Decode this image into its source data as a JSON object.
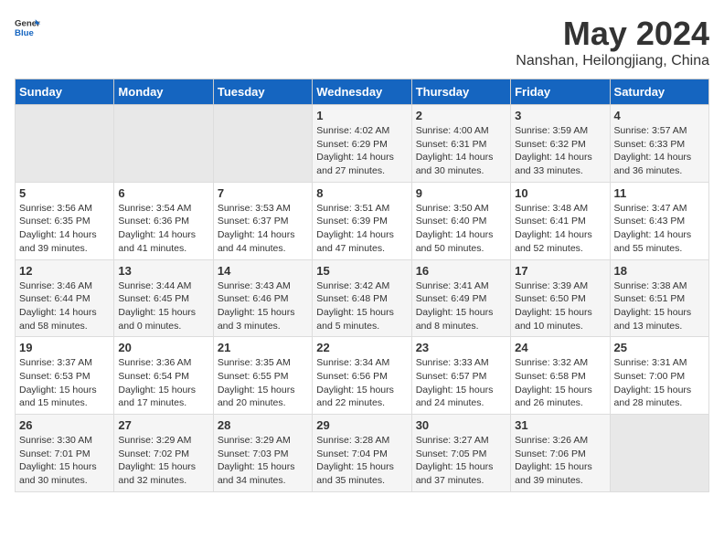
{
  "header": {
    "logo_general": "General",
    "logo_blue": "Blue",
    "main_title": "May 2024",
    "subtitle": "Nanshan, Heilongjiang, China"
  },
  "days_of_week": [
    "Sunday",
    "Monday",
    "Tuesday",
    "Wednesday",
    "Thursday",
    "Friday",
    "Saturday"
  ],
  "weeks": [
    [
      {
        "num": "",
        "sunrise": "",
        "sunset": "",
        "daylight": "",
        "empty": true
      },
      {
        "num": "",
        "sunrise": "",
        "sunset": "",
        "daylight": "",
        "empty": true
      },
      {
        "num": "",
        "sunrise": "",
        "sunset": "",
        "daylight": "",
        "empty": true
      },
      {
        "num": "1",
        "sunrise": "Sunrise: 4:02 AM",
        "sunset": "Sunset: 6:29 PM",
        "daylight": "Daylight: 14 hours and 27 minutes.",
        "empty": false
      },
      {
        "num": "2",
        "sunrise": "Sunrise: 4:00 AM",
        "sunset": "Sunset: 6:31 PM",
        "daylight": "Daylight: 14 hours and 30 minutes.",
        "empty": false
      },
      {
        "num": "3",
        "sunrise": "Sunrise: 3:59 AM",
        "sunset": "Sunset: 6:32 PM",
        "daylight": "Daylight: 14 hours and 33 minutes.",
        "empty": false
      },
      {
        "num": "4",
        "sunrise": "Sunrise: 3:57 AM",
        "sunset": "Sunset: 6:33 PM",
        "daylight": "Daylight: 14 hours and 36 minutes.",
        "empty": false
      }
    ],
    [
      {
        "num": "5",
        "sunrise": "Sunrise: 3:56 AM",
        "sunset": "Sunset: 6:35 PM",
        "daylight": "Daylight: 14 hours and 39 minutes.",
        "empty": false
      },
      {
        "num": "6",
        "sunrise": "Sunrise: 3:54 AM",
        "sunset": "Sunset: 6:36 PM",
        "daylight": "Daylight: 14 hours and 41 minutes.",
        "empty": false
      },
      {
        "num": "7",
        "sunrise": "Sunrise: 3:53 AM",
        "sunset": "Sunset: 6:37 PM",
        "daylight": "Daylight: 14 hours and 44 minutes.",
        "empty": false
      },
      {
        "num": "8",
        "sunrise": "Sunrise: 3:51 AM",
        "sunset": "Sunset: 6:39 PM",
        "daylight": "Daylight: 14 hours and 47 minutes.",
        "empty": false
      },
      {
        "num": "9",
        "sunrise": "Sunrise: 3:50 AM",
        "sunset": "Sunset: 6:40 PM",
        "daylight": "Daylight: 14 hours and 50 minutes.",
        "empty": false
      },
      {
        "num": "10",
        "sunrise": "Sunrise: 3:48 AM",
        "sunset": "Sunset: 6:41 PM",
        "daylight": "Daylight: 14 hours and 52 minutes.",
        "empty": false
      },
      {
        "num": "11",
        "sunrise": "Sunrise: 3:47 AM",
        "sunset": "Sunset: 6:43 PM",
        "daylight": "Daylight: 14 hours and 55 minutes.",
        "empty": false
      }
    ],
    [
      {
        "num": "12",
        "sunrise": "Sunrise: 3:46 AM",
        "sunset": "Sunset: 6:44 PM",
        "daylight": "Daylight: 14 hours and 58 minutes.",
        "empty": false
      },
      {
        "num": "13",
        "sunrise": "Sunrise: 3:44 AM",
        "sunset": "Sunset: 6:45 PM",
        "daylight": "Daylight: 15 hours and 0 minutes.",
        "empty": false
      },
      {
        "num": "14",
        "sunrise": "Sunrise: 3:43 AM",
        "sunset": "Sunset: 6:46 PM",
        "daylight": "Daylight: 15 hours and 3 minutes.",
        "empty": false
      },
      {
        "num": "15",
        "sunrise": "Sunrise: 3:42 AM",
        "sunset": "Sunset: 6:48 PM",
        "daylight": "Daylight: 15 hours and 5 minutes.",
        "empty": false
      },
      {
        "num": "16",
        "sunrise": "Sunrise: 3:41 AM",
        "sunset": "Sunset: 6:49 PM",
        "daylight": "Daylight: 15 hours and 8 minutes.",
        "empty": false
      },
      {
        "num": "17",
        "sunrise": "Sunrise: 3:39 AM",
        "sunset": "Sunset: 6:50 PM",
        "daylight": "Daylight: 15 hours and 10 minutes.",
        "empty": false
      },
      {
        "num": "18",
        "sunrise": "Sunrise: 3:38 AM",
        "sunset": "Sunset: 6:51 PM",
        "daylight": "Daylight: 15 hours and 13 minutes.",
        "empty": false
      }
    ],
    [
      {
        "num": "19",
        "sunrise": "Sunrise: 3:37 AM",
        "sunset": "Sunset: 6:53 PM",
        "daylight": "Daylight: 15 hours and 15 minutes.",
        "empty": false
      },
      {
        "num": "20",
        "sunrise": "Sunrise: 3:36 AM",
        "sunset": "Sunset: 6:54 PM",
        "daylight": "Daylight: 15 hours and 17 minutes.",
        "empty": false
      },
      {
        "num": "21",
        "sunrise": "Sunrise: 3:35 AM",
        "sunset": "Sunset: 6:55 PM",
        "daylight": "Daylight: 15 hours and 20 minutes.",
        "empty": false
      },
      {
        "num": "22",
        "sunrise": "Sunrise: 3:34 AM",
        "sunset": "Sunset: 6:56 PM",
        "daylight": "Daylight: 15 hours and 22 minutes.",
        "empty": false
      },
      {
        "num": "23",
        "sunrise": "Sunrise: 3:33 AM",
        "sunset": "Sunset: 6:57 PM",
        "daylight": "Daylight: 15 hours and 24 minutes.",
        "empty": false
      },
      {
        "num": "24",
        "sunrise": "Sunrise: 3:32 AM",
        "sunset": "Sunset: 6:58 PM",
        "daylight": "Daylight: 15 hours and 26 minutes.",
        "empty": false
      },
      {
        "num": "25",
        "sunrise": "Sunrise: 3:31 AM",
        "sunset": "Sunset: 7:00 PM",
        "daylight": "Daylight: 15 hours and 28 minutes.",
        "empty": false
      }
    ],
    [
      {
        "num": "26",
        "sunrise": "Sunrise: 3:30 AM",
        "sunset": "Sunset: 7:01 PM",
        "daylight": "Daylight: 15 hours and 30 minutes.",
        "empty": false
      },
      {
        "num": "27",
        "sunrise": "Sunrise: 3:29 AM",
        "sunset": "Sunset: 7:02 PM",
        "daylight": "Daylight: 15 hours and 32 minutes.",
        "empty": false
      },
      {
        "num": "28",
        "sunrise": "Sunrise: 3:29 AM",
        "sunset": "Sunset: 7:03 PM",
        "daylight": "Daylight: 15 hours and 34 minutes.",
        "empty": false
      },
      {
        "num": "29",
        "sunrise": "Sunrise: 3:28 AM",
        "sunset": "Sunset: 7:04 PM",
        "daylight": "Daylight: 15 hours and 35 minutes.",
        "empty": false
      },
      {
        "num": "30",
        "sunrise": "Sunrise: 3:27 AM",
        "sunset": "Sunset: 7:05 PM",
        "daylight": "Daylight: 15 hours and 37 minutes.",
        "empty": false
      },
      {
        "num": "31",
        "sunrise": "Sunrise: 3:26 AM",
        "sunset": "Sunset: 7:06 PM",
        "daylight": "Daylight: 15 hours and 39 minutes.",
        "empty": false
      },
      {
        "num": "",
        "sunrise": "",
        "sunset": "",
        "daylight": "",
        "empty": true
      }
    ]
  ]
}
